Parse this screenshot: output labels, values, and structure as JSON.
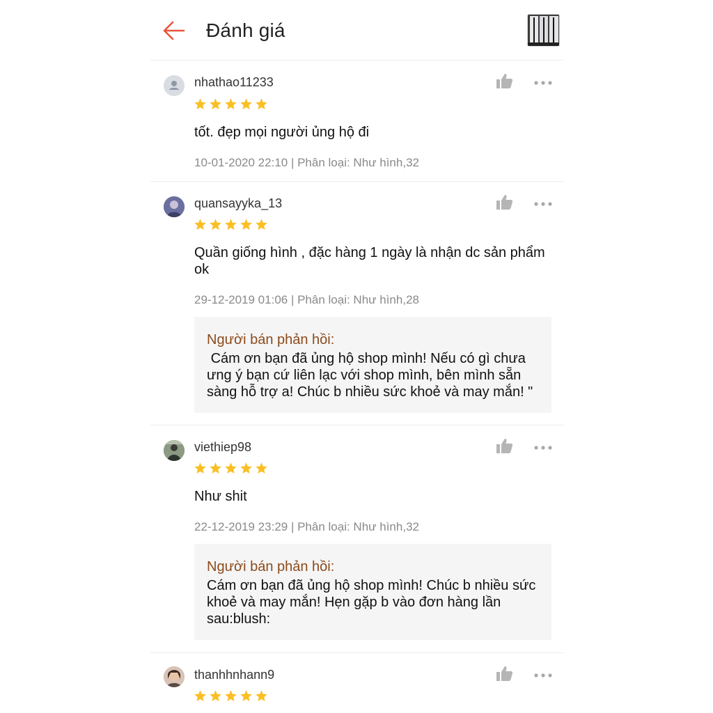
{
  "header": {
    "title": "Đánh giá",
    "back_icon": "arrow-left-icon",
    "accent_color": "#ee4d2d"
  },
  "reviews": [
    {
      "username": "nhathao11233",
      "rating": 5,
      "comment": "tốt. đẹp mọi người ủng hộ đi",
      "meta": "10-01-2020 22:10 | Phân loại: Như hình,32"
    },
    {
      "username": "quansayyka_13",
      "rating": 5,
      "comment": "Quần giống hình , đặc hàng 1 ngày là nhận dc sản phẩm ok",
      "meta": "29-12-2019 01:06 | Phân loại: Như hình,28",
      "reply_label": "Người bán phản hồi:",
      "reply_text": " Cám ơn bạn đã ủng hộ shop mình! Nếu có gì chưa ưng ý bạn cứ liên lạc với shop mình, bên mình sẵn sàng hỗ trợ a! Chúc b nhiều sức khoẻ và may mắn! \""
    },
    {
      "username": "viethiep98",
      "rating": 5,
      "comment": "Như shit",
      "meta": "22-12-2019 23:29 | Phân loại: Như hình,32",
      "reply_label": "Người bán phản hồi:",
      "reply_text": "Cám ơn bạn đã ủng hộ shop mình! Chúc b nhiều sức khoẻ và may mắn! Hẹn gặp b vào đơn hàng lần sau:blush:"
    },
    {
      "username": "thanhhnhann9",
      "rating": 5
    }
  ],
  "colors": {
    "star": "#fbbf24",
    "reply_label": "#8b4a1a",
    "meta_text": "#8a8a8a",
    "icon_gray": "#b5b5b5"
  }
}
